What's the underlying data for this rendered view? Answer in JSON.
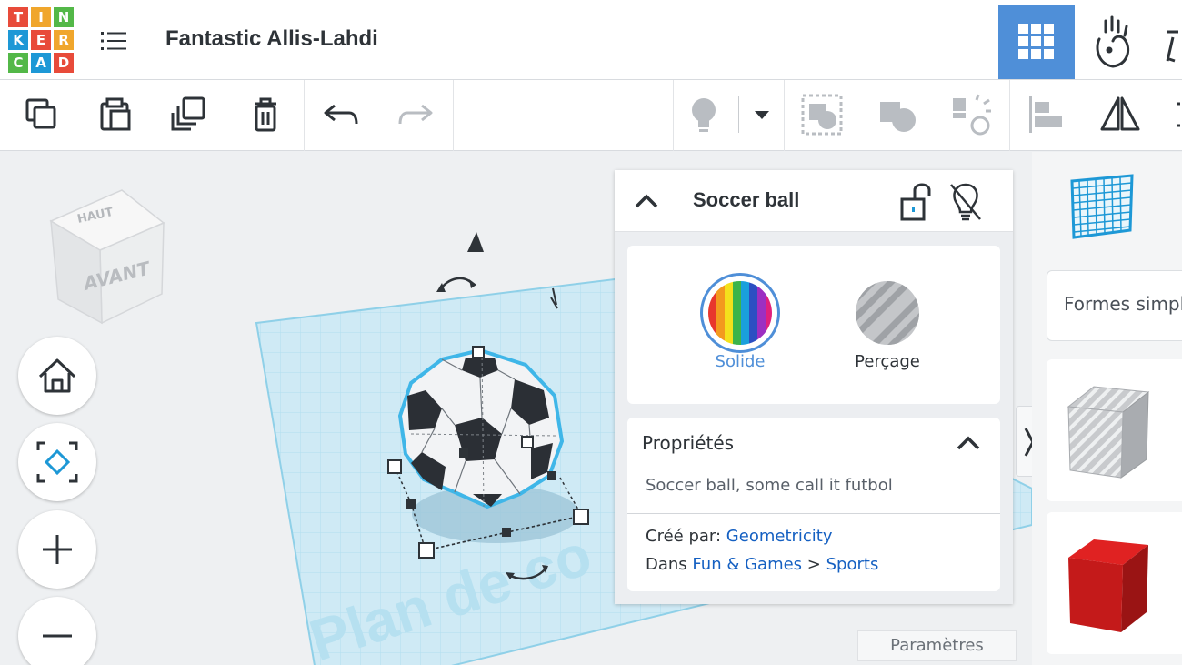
{
  "app": {
    "logo_letters": [
      "T",
      "I",
      "N",
      "K",
      "E",
      "R",
      "C",
      "A",
      "D"
    ],
    "logo_colors": [
      "#e84b3a",
      "#f0a62c",
      "#53b848",
      "#1d98d6",
      "#e84b3a",
      "#f0a62c",
      "#53b848",
      "#1d98d6",
      "#e84b3a"
    ],
    "document_title": "Fantastic Allis-Lahdi"
  },
  "header": {
    "menu_icon": "list-menu-icon",
    "view_buttons": [
      {
        "icon": "grid-view-icon",
        "active": true
      },
      {
        "icon": "simulation-view-icon",
        "active": false
      },
      {
        "icon": "other-view-icon",
        "active": false
      }
    ]
  },
  "toolbar": {
    "buttons": [
      {
        "icon": "copy-icon",
        "enabled": true
      },
      {
        "icon": "paste-icon",
        "enabled": true
      },
      {
        "icon": "duplicate-icon",
        "enabled": true
      },
      {
        "icon": "trash-icon",
        "enabled": true
      },
      {
        "icon": "undo-icon",
        "enabled": true
      },
      {
        "icon": "redo-icon",
        "enabled": false
      },
      {
        "icon": "lightbulb-icon",
        "enabled": false
      },
      {
        "icon": "chevron-down-icon",
        "enabled": true
      },
      {
        "icon": "group-icon",
        "enabled": false
      },
      {
        "icon": "ungroup-icon",
        "enabled": false
      },
      {
        "icon": "explode-icon",
        "enabled": false
      },
      {
        "icon": "align-icon",
        "enabled": false
      },
      {
        "icon": "mirror-icon",
        "enabled": true
      }
    ]
  },
  "viewcube": {
    "top_label": "HAUT",
    "front_label": "AVANT"
  },
  "nav_controls": [
    "home-icon",
    "fit-view-icon",
    "zoom-in-icon",
    "zoom-out-icon"
  ],
  "workplane": {
    "label": "Plan de co"
  },
  "inspector": {
    "shape_name": "Soccer ball",
    "materials": [
      {
        "label": "Solide",
        "selected": true
      },
      {
        "label": "Perçage",
        "selected": false
      }
    ],
    "properties": {
      "title": "Propriétés",
      "description": "Soccer ball, some call it futbol",
      "created_by_label": "Créé par:",
      "author": "Geometricity",
      "in_label": "Dans",
      "category": "Fun & Games",
      "separator": ">",
      "subcategory": "Sports"
    }
  },
  "settings_button": "Paramètres",
  "shapes_panel": {
    "dropdown_label": "Formes simples",
    "shapes": [
      {
        "icon": "hole-box-icon",
        "color": "#b9bcc0"
      },
      {
        "icon": "box-icon",
        "color": "#c41a1a"
      }
    ]
  },
  "colors": {
    "accent": "#4f8fd8",
    "selection": "#3fb6e8",
    "link": "#1560c2"
  }
}
